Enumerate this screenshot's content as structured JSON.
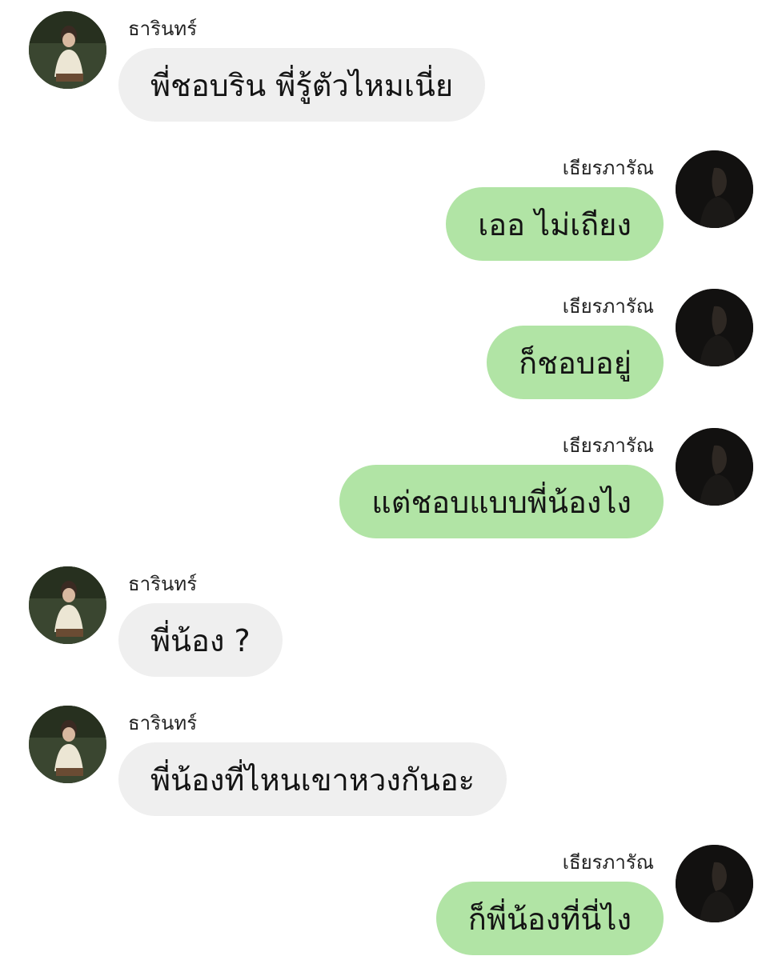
{
  "messages": [
    {
      "side": "left",
      "name": "ธารินทร์",
      "text": "พี่ชอบริน พี่รู้ตัวไหมเนี่ย"
    },
    {
      "side": "right",
      "name": "เธียรภารัณ",
      "text": "เออ ไม่เถียง"
    },
    {
      "side": "right",
      "name": "เธียรภารัณ",
      "text": "ก็ชอบอยู่"
    },
    {
      "side": "right",
      "name": "เธียรภารัณ",
      "text": "แต่ชอบแบบพี่น้องไง"
    },
    {
      "side": "left",
      "name": "ธารินทร์",
      "text": "พี่น้อง ?"
    },
    {
      "side": "left",
      "name": "ธารินทร์",
      "text": "พี่น้องที่ไหนเขาหวงกันอะ"
    },
    {
      "side": "right",
      "name": "เธียรภารัณ",
      "text": "ก็พี่น้องที่นี่ไง"
    }
  ],
  "colors": {
    "left_bubble": "#efefef",
    "right_bubble": "#b1e4a5"
  }
}
